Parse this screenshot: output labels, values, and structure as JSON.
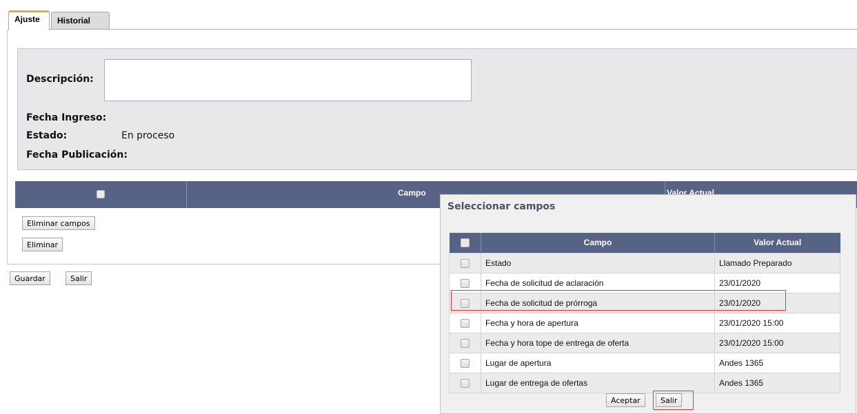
{
  "tabs": [
    {
      "label": "Ajuste",
      "active": true
    },
    {
      "label": "Historial",
      "active": false
    }
  ],
  "info": {
    "descripcion_label": "Descripción:",
    "descripcion_value": "",
    "fecha_ingreso_label": "Fecha Ingreso:",
    "fecha_ingreso_value": "",
    "estado_label": "Estado:",
    "estado_value": "En proceso",
    "fecha_publicacion_label": "Fecha Publicación:",
    "fecha_publicacion_value": ""
  },
  "main_table": {
    "columns": [
      "",
      "Campo",
      "Valor Actual"
    ]
  },
  "buttons": {
    "eliminar_campos": "Eliminar campos",
    "eliminar": "Eliminar",
    "guardar": "Guardar",
    "salir": "Salir"
  },
  "modal": {
    "title": "Seleccionar campos",
    "columns": [
      "",
      "Campo",
      "Valor Actual"
    ],
    "rows": [
      {
        "campo": "Estado",
        "valor": "Llamado Preparado"
      },
      {
        "campo": "Fecha de solicitud de aclaración",
        "valor": "23/01/2020"
      },
      {
        "campo": "Fecha de solicitud de prórroga",
        "valor": "23/01/2020"
      },
      {
        "campo": "Fecha y hora de apertura",
        "valor": "23/01/2020 15:00"
      },
      {
        "campo": "Fecha y hora tope de entrega de oferta",
        "valor": "23/01/2020 15:00"
      },
      {
        "campo": "Lugar de apertura",
        "valor": "Andes 1365"
      },
      {
        "campo": "Lugar de entrega de ofertas",
        "valor": "Andes 1365"
      }
    ],
    "aceptar_label": "Aceptar",
    "salir_label": "Salir"
  },
  "colors": {
    "header_bg": "#566384",
    "tab_accent": "#f0a830",
    "panel_bg": "#e8e8ea",
    "highlight": "#e03a3a"
  }
}
